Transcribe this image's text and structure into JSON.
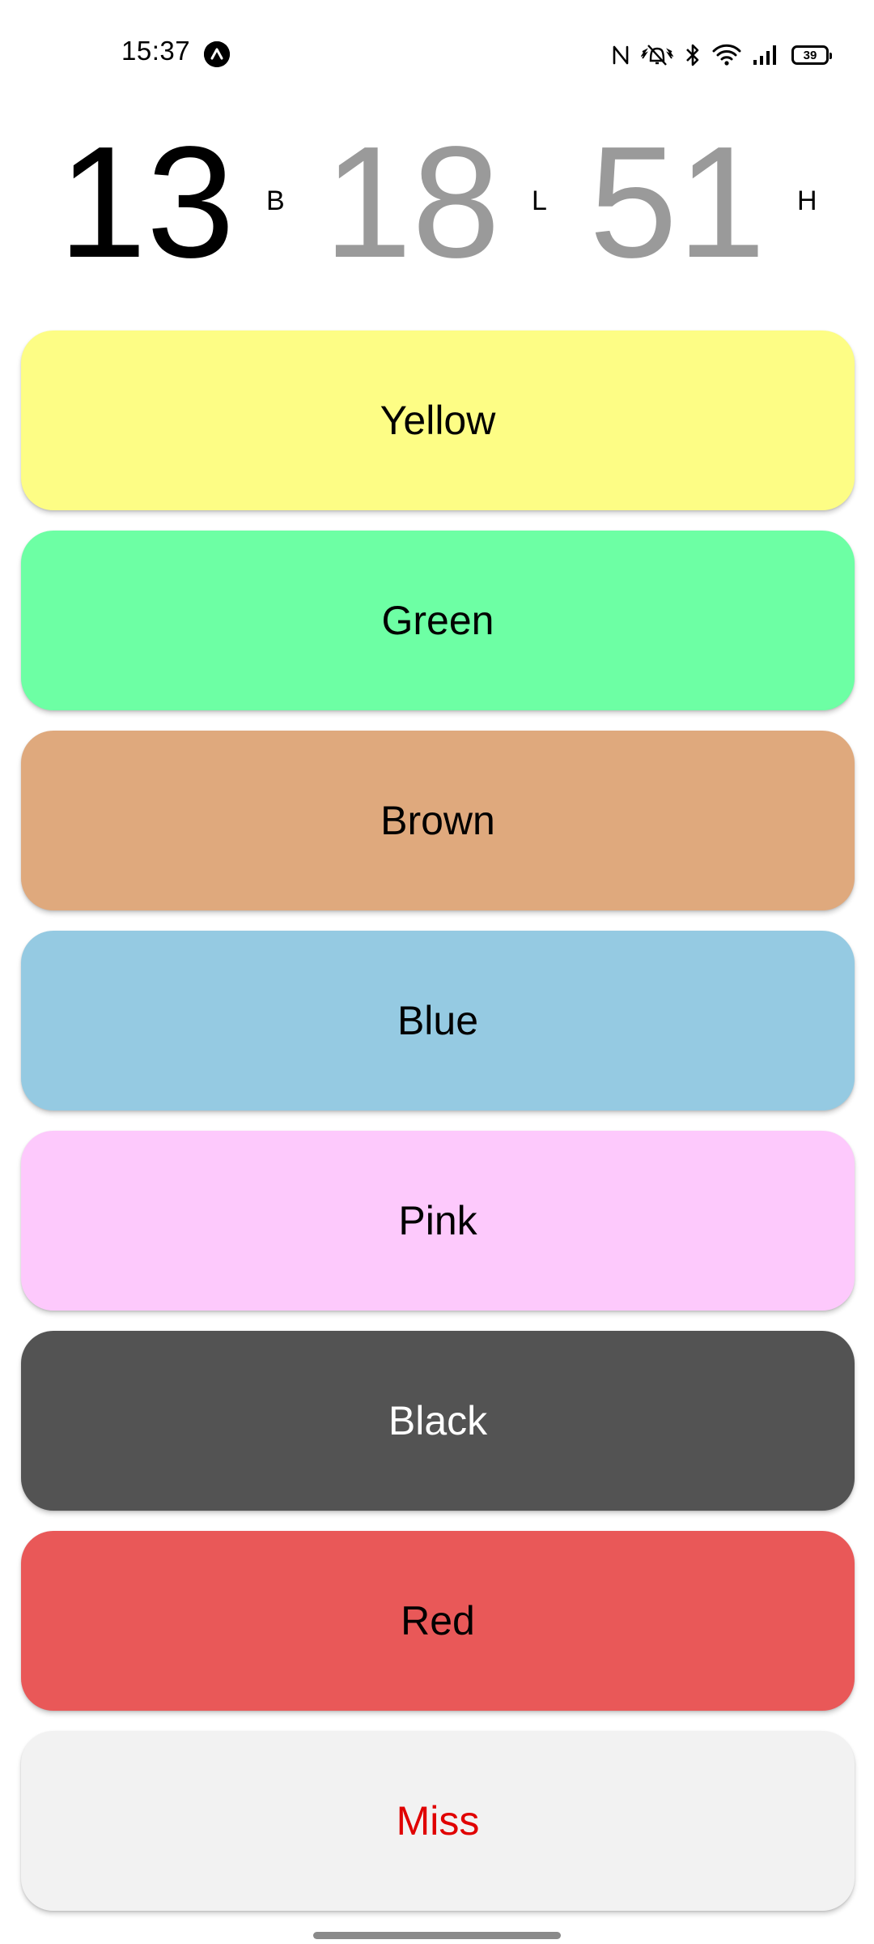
{
  "status_bar": {
    "time": "15:37",
    "notification_icon": "app-logo-icon",
    "icons": [
      "nfc-icon",
      "vibrate-icon",
      "bluetooth-icon",
      "wifi-icon",
      "signal-icon",
      "battery-icon"
    ],
    "battery_level": "39"
  },
  "counters": {
    "b": {
      "value": "13",
      "label": "B",
      "color": "#000000"
    },
    "l": {
      "value": "18",
      "label": "L",
      "color": "#9a9a9a"
    },
    "h": {
      "value": "51",
      "label": "H",
      "color": "#9a9a9a"
    }
  },
  "buttons": [
    {
      "label": "Yellow",
      "bg": "#fdfd85",
      "text_color": "#000000"
    },
    {
      "label": "Green",
      "bg": "#6dffa4",
      "text_color": "#000000"
    },
    {
      "label": "Brown",
      "bg": "#dfa97d",
      "text_color": "#000000"
    },
    {
      "label": "Blue",
      "bg": "#95cae2",
      "text_color": "#000000"
    },
    {
      "label": "Pink",
      "bg": "#fdc9fc",
      "text_color": "#000000"
    },
    {
      "label": "Black",
      "bg": "#535353",
      "text_color": "#ffffff"
    },
    {
      "label": "Red",
      "bg": "#e95858",
      "text_color": "#000000"
    },
    {
      "label": "Miss",
      "bg": "#f2f2f2",
      "text_color": "#e00000"
    }
  ]
}
